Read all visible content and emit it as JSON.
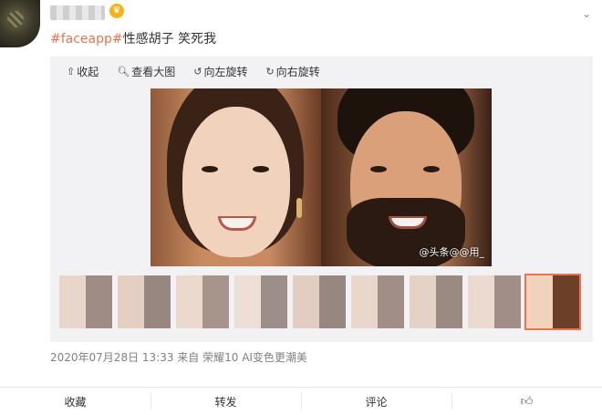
{
  "post": {
    "hashtag": "#faceapp#",
    "text": "性感胡子 笑死我",
    "meta": "2020年07月28日 13:33  来自 荣耀10 AI变色更潮美"
  },
  "toolbar": {
    "collapse_label": "收起",
    "view_large_label": "查看大图",
    "rotate_left_label": "向左旋转",
    "rotate_right_label": "向右旋转"
  },
  "image": {
    "watermark": "@头条@@用_"
  },
  "thumbnails": {
    "count": 9,
    "selected_index": 8
  },
  "actions": {
    "favorite_label": "收藏",
    "repost_label": "转发",
    "comment_label": "评论"
  },
  "icons": {
    "crown": "crown-icon",
    "chevron": "chevron-down-icon",
    "like": "thumbs-up-icon"
  },
  "colors": {
    "accent": "#eb7350"
  }
}
